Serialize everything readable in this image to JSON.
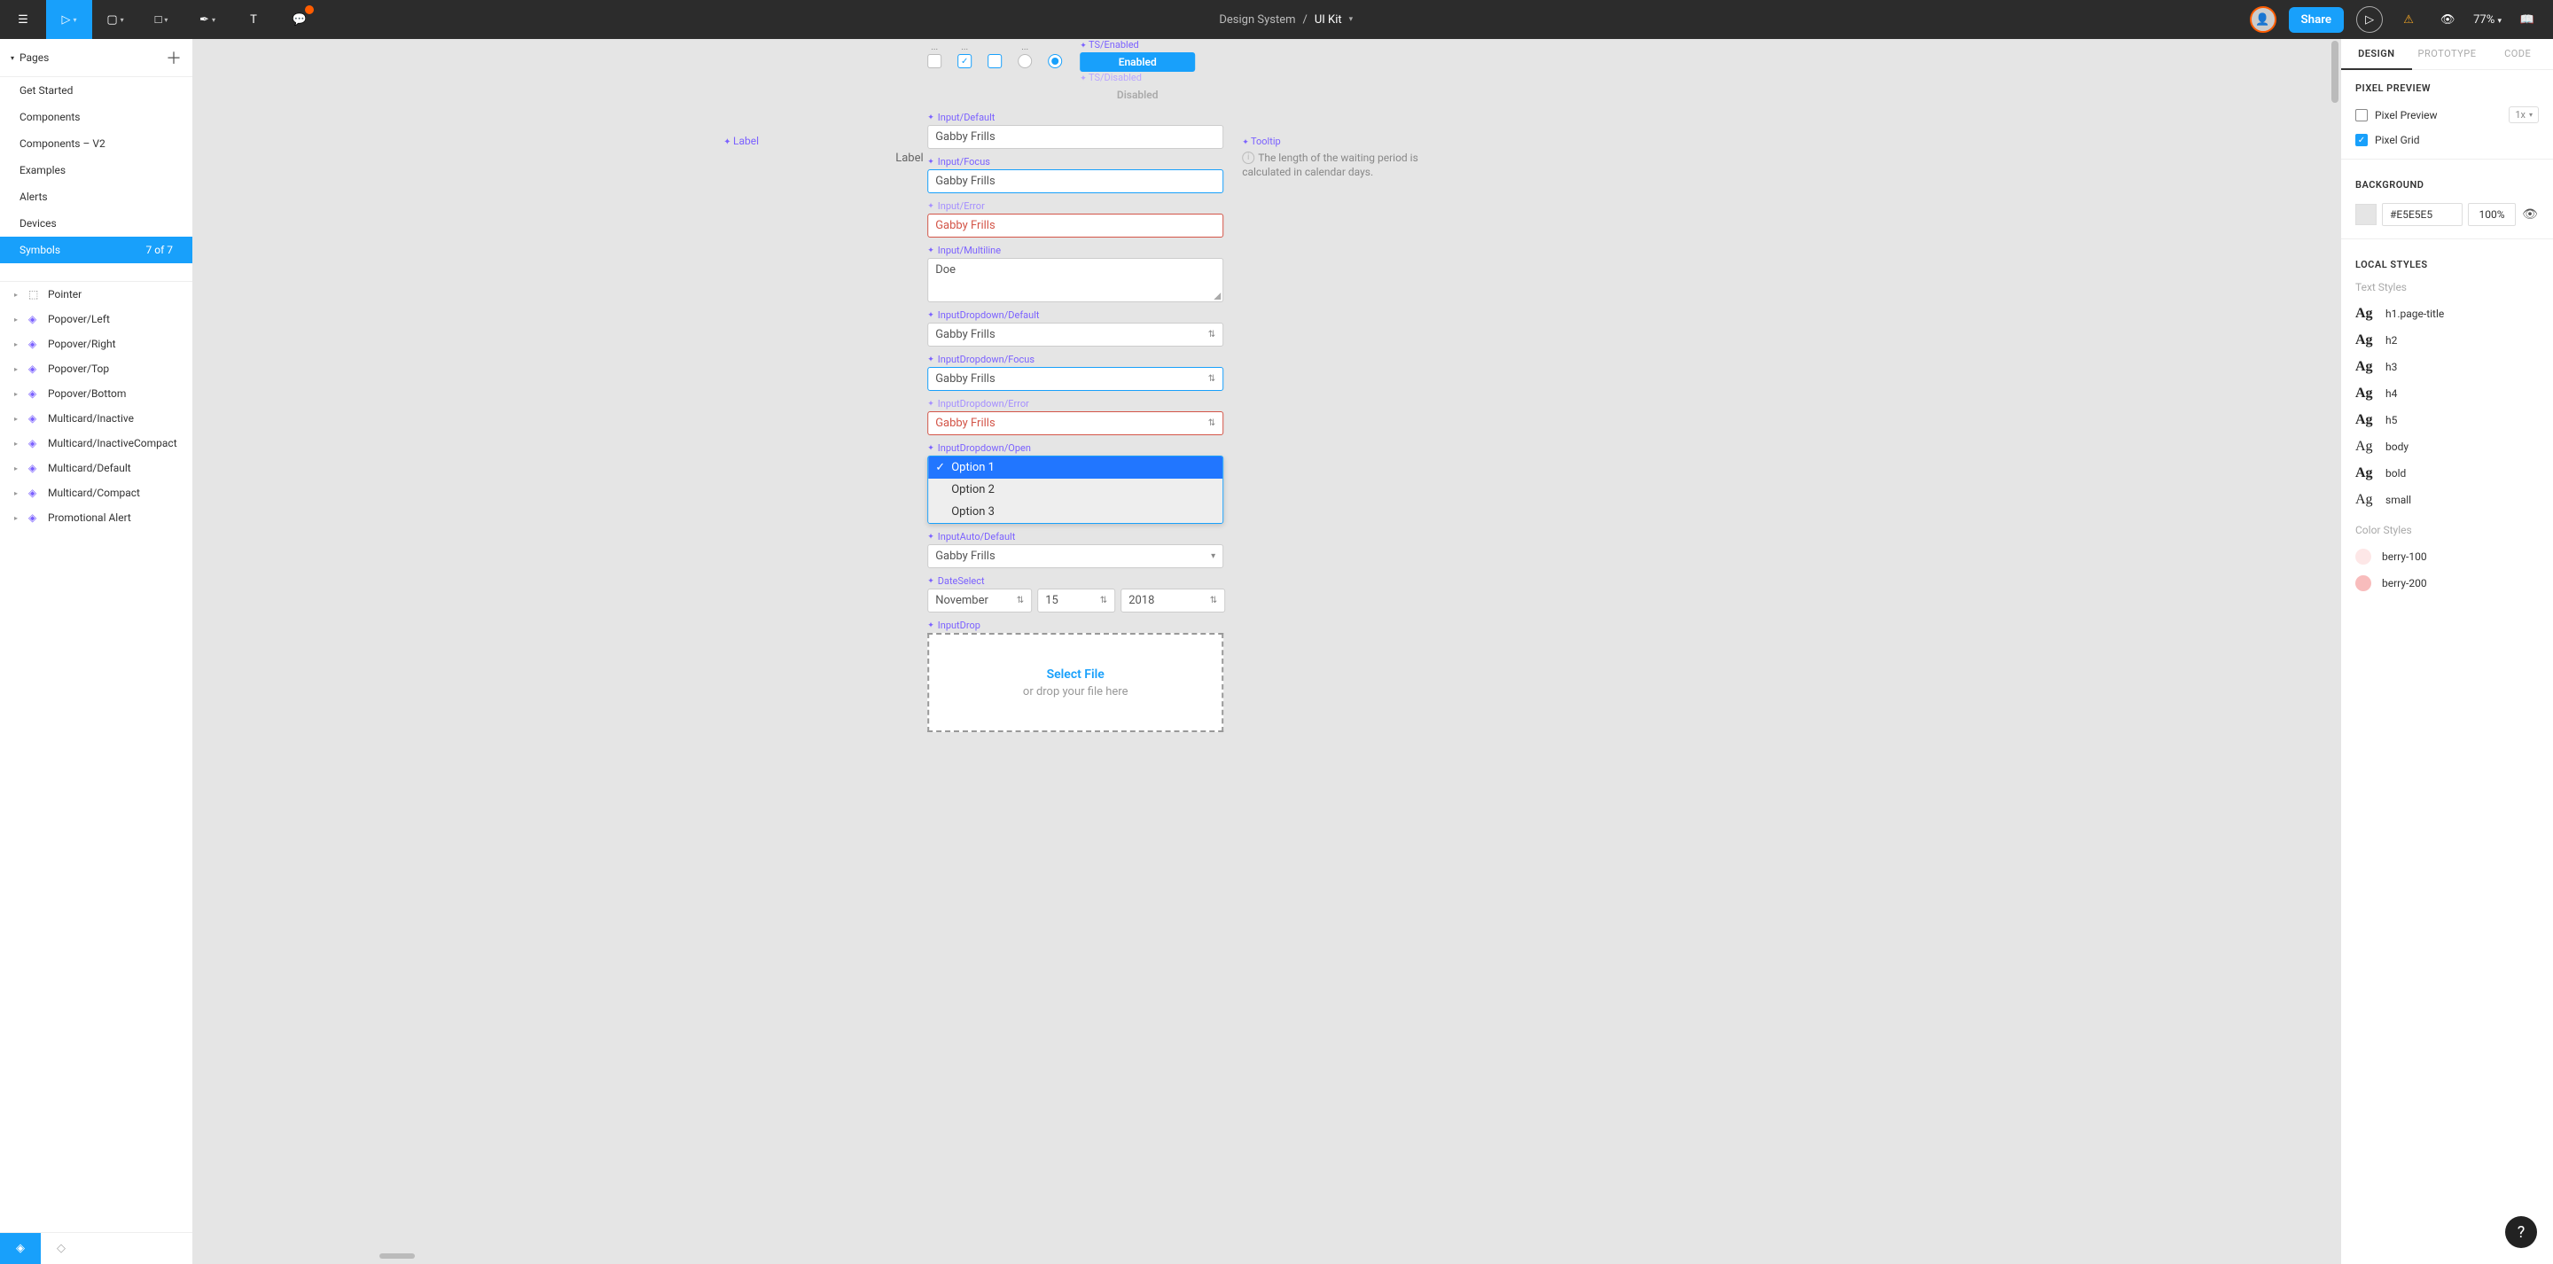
{
  "toolbar": {
    "breadcrumb_project": "Design System",
    "breadcrumb_file": "UI Kit",
    "share_label": "Share",
    "zoom": "77%"
  },
  "left": {
    "pages_header": "Pages",
    "pages": [
      {
        "name": "Get Started"
      },
      {
        "name": "Components"
      },
      {
        "name": "Components – V2"
      },
      {
        "name": "Examples"
      },
      {
        "name": "Alerts"
      },
      {
        "name": "Devices"
      },
      {
        "name": "Symbols",
        "active": true,
        "count": "7 of 7"
      }
    ],
    "layers": [
      {
        "name": "Pointer",
        "type": "frame"
      },
      {
        "name": "Popover/Left",
        "type": "component"
      },
      {
        "name": "Popover/Right",
        "type": "component"
      },
      {
        "name": "Popover/Top",
        "type": "component"
      },
      {
        "name": "Popover/Bottom",
        "type": "component"
      },
      {
        "name": "Multicard/Inactive",
        "type": "component"
      },
      {
        "name": "Multicard/InactiveCompact",
        "type": "component"
      },
      {
        "name": "Multicard/Default",
        "type": "component"
      },
      {
        "name": "Multicard/Compact",
        "type": "component"
      },
      {
        "name": "Promotional Alert",
        "type": "component"
      }
    ]
  },
  "canvas": {
    "dots": "...",
    "label_marker": "Label",
    "side_label": "Label",
    "ts_enabled_label": "TS/Enabled",
    "ts_enabled_text": "Enabled",
    "ts_disabled_label": "TS/Disabled",
    "ts_disabled_text": "Disabled",
    "input_default_label": "Input/Default",
    "input_default_value": "Gabby Frills",
    "input_focus_label": "Input/Focus",
    "input_focus_value": "Gabby Frills",
    "input_error_label": "Input/Error",
    "input_error_value": "Gabby Frills",
    "input_multiline_label": "Input/Multiline",
    "input_multiline_value": "Doe",
    "dd_default_label": "InputDropdown/Default",
    "dd_default_value": "Gabby Frills",
    "dd_focus_label": "InputDropdown/Focus",
    "dd_focus_value": "Gabby Frills",
    "dd_error_label": "InputDropdown/Error",
    "dd_error_value": "Gabby Frills",
    "dd_open_label": "InputDropdown/Open",
    "dd_open_options": [
      "Option 1",
      "Option 2",
      "Option 3"
    ],
    "auto_label": "InputAuto/Default",
    "auto_value": "Gabby Frills",
    "date_label": "DateSelect",
    "date_month": "November",
    "date_day": "15",
    "date_year": "2018",
    "drop_label": "InputDrop",
    "drop_select": "Select File",
    "drop_sub": "or drop your file here",
    "tooltip_label": "Tooltip",
    "tooltip_text": "The length of the waiting period is calculated in calendar days."
  },
  "right": {
    "tabs": [
      "DESIGN",
      "PROTOTYPE",
      "CODE"
    ],
    "pixel_preview_section": "PIXEL PREVIEW",
    "pixel_preview": "Pixel Preview",
    "pixel_preview_scale": "1x",
    "pixel_grid": "Pixel Grid",
    "background_section": "BACKGROUND",
    "background_hex": "#E5E5E5",
    "background_opacity": "100%",
    "local_styles_section": "LOCAL STYLES",
    "text_styles_header": "Text Styles",
    "text_styles": [
      {
        "name": "h1.page-title",
        "weight": "bold"
      },
      {
        "name": "h2",
        "weight": "bold"
      },
      {
        "name": "h3",
        "weight": "bold"
      },
      {
        "name": "h4",
        "weight": "bold"
      },
      {
        "name": "h5",
        "weight": "bold"
      },
      {
        "name": "body",
        "weight": "thin"
      },
      {
        "name": "bold",
        "weight": "bold"
      },
      {
        "name": "small",
        "weight": "thin"
      }
    ],
    "color_styles_header": "Color Styles",
    "color_styles": [
      {
        "name": "berry-100",
        "hex": "#fde7e7"
      },
      {
        "name": "berry-200",
        "hex": "#f8bcbc"
      }
    ]
  }
}
